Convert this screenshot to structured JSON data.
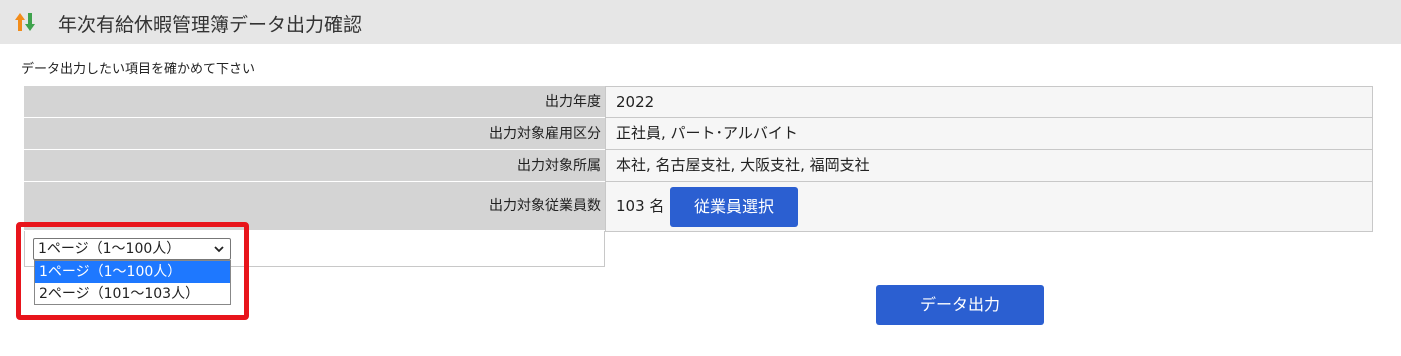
{
  "header": {
    "title": "年次有給休暇管理簿データ出力確認",
    "icon": "sort-arrows-icon"
  },
  "instruction": "データ出力したい項目を確かめて下さい",
  "rows": [
    {
      "label": "出力年度",
      "value": "2022"
    },
    {
      "label": "出力対象雇用区分",
      "value": "正社員, パート･アルバイト"
    },
    {
      "label": "出力対象所属",
      "value": "本社, 名古屋支社, 大阪支社, 福岡支社"
    },
    {
      "label": "出力対象従業員数",
      "value": "103 名"
    }
  ],
  "employee_select_button": "従業員選択",
  "page_select": {
    "selected": "1ページ（1〜100人）",
    "options": [
      "1ページ（1〜100人）",
      "2ページ（101〜103人）"
    ]
  },
  "export_button": "データ出力",
  "colors": {
    "accent": "#2b5fd1",
    "highlight": "#e8141b",
    "option_selected": "#1e78ff",
    "label_bg": "#d4d4d4",
    "value_bg": "#f6f6f6",
    "header_bg": "#e6e6e6"
  }
}
